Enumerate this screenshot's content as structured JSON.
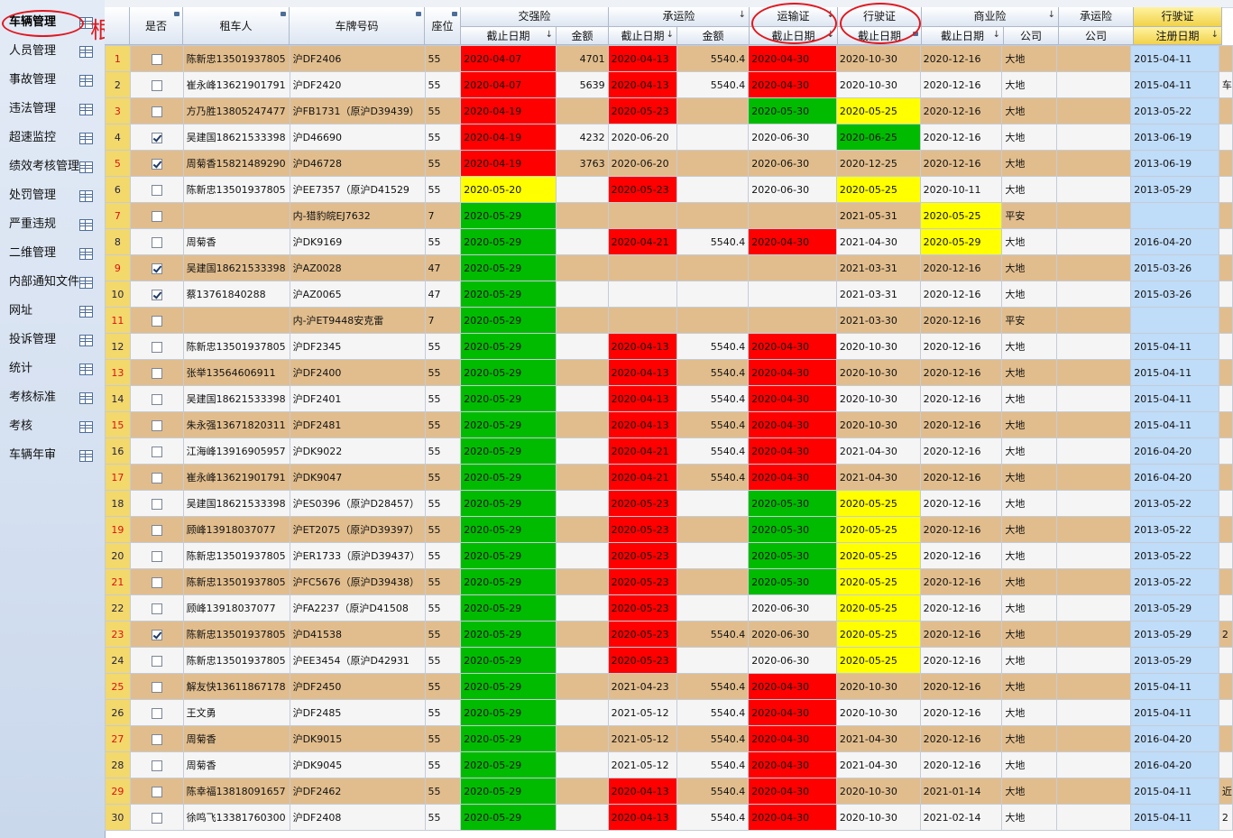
{
  "annotation": {
    "text": "根据该表"
  },
  "sidebar": {
    "items": [
      {
        "label": "车辆管理"
      },
      {
        "label": "人员管理"
      },
      {
        "label": "事故管理"
      },
      {
        "label": "违法管理"
      },
      {
        "label": "超速监控"
      },
      {
        "label": "绩效考核管理"
      },
      {
        "label": "处罚管理"
      },
      {
        "label": "严重违规"
      },
      {
        "label": "二维管理"
      },
      {
        "label": "内部通知文件"
      },
      {
        "label": "网址"
      },
      {
        "label": "投诉管理"
      },
      {
        "label": "统计"
      },
      {
        "label": "考核标准"
      },
      {
        "label": "考核"
      },
      {
        "label": "车辆年审"
      }
    ]
  },
  "header": {
    "top": {
      "col_checkbox": "是否",
      "col_renter": "租车人",
      "col_plate": "车牌号码",
      "col_seat": "座位",
      "group_jqx": "交强险",
      "group_cyx": "承运险",
      "group_ysz": "运输证",
      "group_xsz": "行驶证",
      "group_syx": "商业险",
      "group_cyx2": "承运险",
      "group_xsz2": "行驶证"
    },
    "bottom": {
      "jqx_date": "截止日期",
      "jqx_amount": "金额",
      "cyx_date": "截止日期",
      "cyx_amount": "金额",
      "ysz_date": "截止日期",
      "xsz_date": "截止日期",
      "syx_date": "截止日期",
      "syx_company": "公司",
      "cyx2_company": "公司",
      "xsz2_regdate": "注册日期"
    }
  },
  "colors": {
    "red": "#ff0000",
    "green": "#00bb00",
    "yellow": "#ffff00",
    "odd_row": "#e1bd8d",
    "even_row": "#f5f5f5",
    "reg_col": "#bfdcf8",
    "annotation": "#e0181f"
  },
  "rows": [
    {
      "n": "1",
      "c": false,
      "renter": "陈新忠13501937805",
      "plate": "沪DF2406",
      "seat": "55",
      "jqx": "2020-04-07",
      "jqx_c": "red",
      "jqx_amt": "4701",
      "cyx": "2020-04-13",
      "cyx_c": "red",
      "cyx_amt": "5540.4",
      "ysz": "2020-04-30",
      "ysz_c": "red",
      "xsz": "2020-10-30",
      "xsz_c": "",
      "syx": "2020-12-16",
      "syx_c": "",
      "co": "大地",
      "co2": "",
      "reg": "2015-04-11",
      "extra": ""
    },
    {
      "n": "2",
      "c": false,
      "renter": "崔永峰13621901791",
      "plate": "沪DF2420",
      "seat": "55",
      "jqx": "2020-04-07",
      "jqx_c": "red",
      "jqx_amt": "5639",
      "cyx": "2020-04-13",
      "cyx_c": "red",
      "cyx_amt": "5540.4",
      "ysz": "2020-04-30",
      "ysz_c": "red",
      "xsz": "2020-10-30",
      "xsz_c": "",
      "syx": "2020-12-16",
      "syx_c": "",
      "co": "大地",
      "co2": "",
      "reg": "2015-04-11",
      "extra": "车"
    },
    {
      "n": "3",
      "c": false,
      "renter": "方乃胜13805247477",
      "plate": "沪FB1731（原沪D39439）",
      "seat": "55",
      "jqx": "2020-04-19",
      "jqx_c": "red",
      "jqx_amt": "",
      "cyx": "2020-05-23",
      "cyx_c": "red",
      "cyx_amt": "",
      "ysz": "2020-05-30",
      "ysz_c": "green",
      "xsz": "2020-05-25",
      "xsz_c": "yellow",
      "syx": "2020-12-16",
      "syx_c": "",
      "co": "大地",
      "co2": "",
      "reg": "2013-05-22",
      "extra": ""
    },
    {
      "n": "4",
      "c": true,
      "renter": "吴建国18621533398",
      "plate": "沪D46690",
      "seat": "55",
      "jqx": "2020-04-19",
      "jqx_c": "red",
      "jqx_amt": "4232",
      "cyx": "2020-06-20",
      "cyx_c": "",
      "cyx_amt": "",
      "ysz": "2020-06-30",
      "ysz_c": "",
      "xsz": "2020-06-25",
      "xsz_c": "green",
      "syx": "2020-12-16",
      "syx_c": "",
      "co": "大地",
      "co2": "",
      "reg": "2013-06-19",
      "extra": ""
    },
    {
      "n": "5",
      "c": true,
      "renter": "周菊香15821489290",
      "plate": "沪D46728",
      "seat": "55",
      "jqx": "2020-04-19",
      "jqx_c": "red",
      "jqx_amt": "3763",
      "cyx": "2020-06-20",
      "cyx_c": "",
      "cyx_amt": "",
      "ysz": "2020-06-30",
      "ysz_c": "",
      "xsz": "2020-12-25",
      "xsz_c": "",
      "syx": "2020-12-16",
      "syx_c": "",
      "co": "大地",
      "co2": "",
      "reg": "2013-06-19",
      "extra": ""
    },
    {
      "n": "6",
      "c": false,
      "renter": "陈新忠13501937805",
      "plate": "沪EE7357（原沪D41529",
      "seat": "55",
      "jqx": "2020-05-20",
      "jqx_c": "yellow",
      "jqx_amt": "",
      "cyx": "2020-05-23",
      "cyx_c": "red",
      "cyx_amt": "",
      "ysz": "2020-06-30",
      "ysz_c": "",
      "xsz": "2020-05-25",
      "xsz_c": "yellow",
      "syx": "2020-10-11",
      "syx_c": "",
      "co": "大地",
      "co2": "",
      "reg": "2013-05-29",
      "extra": ""
    },
    {
      "n": "7",
      "c": false,
      "renter": "",
      "plate": "内-猎豹皖EJ7632",
      "seat": "7",
      "jqx": "2020-05-29",
      "jqx_c": "green",
      "jqx_amt": "",
      "cyx": "",
      "cyx_c": "",
      "cyx_amt": "",
      "ysz": "",
      "ysz_c": "",
      "xsz": "2021-05-31",
      "xsz_c": "",
      "syx": "2020-05-25",
      "syx_c": "yellow",
      "co": "平安",
      "co2": "",
      "reg": "",
      "extra": ""
    },
    {
      "n": "8",
      "c": false,
      "renter": "周菊香",
      "plate": "沪DK9169",
      "seat": "55",
      "jqx": "2020-05-29",
      "jqx_c": "green",
      "jqx_amt": "",
      "cyx": "2020-04-21",
      "cyx_c": "red",
      "cyx_amt": "5540.4",
      "ysz": "2020-04-30",
      "ysz_c": "red",
      "xsz": "2021-04-30",
      "xsz_c": "",
      "syx": "2020-05-29",
      "syx_c": "yellow",
      "co": "大地",
      "co2": "",
      "reg": "2016-04-20",
      "extra": ""
    },
    {
      "n": "9",
      "c": true,
      "renter": "吴建国18621533398",
      "plate": "沪AZ0028",
      "seat": "47",
      "jqx": "2020-05-29",
      "jqx_c": "green",
      "jqx_amt": "",
      "cyx": "",
      "cyx_c": "",
      "cyx_amt": "",
      "ysz": "",
      "ysz_c": "",
      "xsz": "2021-03-31",
      "xsz_c": "",
      "syx": "2020-12-16",
      "syx_c": "",
      "co": "大地",
      "co2": "",
      "reg": "2015-03-26",
      "extra": ""
    },
    {
      "n": "10",
      "c": true,
      "renter": "蔡13761840288",
      "plate": "沪AZ0065",
      "seat": "47",
      "jqx": "2020-05-29",
      "jqx_c": "green",
      "jqx_amt": "",
      "cyx": "",
      "cyx_c": "",
      "cyx_amt": "",
      "ysz": "",
      "ysz_c": "",
      "xsz": "2021-03-31",
      "xsz_c": "",
      "syx": "2020-12-16",
      "syx_c": "",
      "co": "大地",
      "co2": "",
      "reg": "2015-03-26",
      "extra": ""
    },
    {
      "n": "11",
      "c": false,
      "renter": "",
      "plate": "内-沪ET9448安克雷",
      "seat": "7",
      "jqx": "2020-05-29",
      "jqx_c": "green",
      "jqx_amt": "",
      "cyx": "",
      "cyx_c": "",
      "cyx_amt": "",
      "ysz": "",
      "ysz_c": "",
      "xsz": "2021-03-30",
      "xsz_c": "",
      "syx": "2020-12-16",
      "syx_c": "",
      "co": "平安",
      "co2": "",
      "reg": "",
      "extra": ""
    },
    {
      "n": "12",
      "c": false,
      "renter": "陈新忠13501937805",
      "plate": "沪DF2345",
      "seat": "55",
      "jqx": "2020-05-29",
      "jqx_c": "green",
      "jqx_amt": "",
      "cyx": "2020-04-13",
      "cyx_c": "red",
      "cyx_amt": "5540.4",
      "ysz": "2020-04-30",
      "ysz_c": "red",
      "xsz": "2020-10-30",
      "xsz_c": "",
      "syx": "2020-12-16",
      "syx_c": "",
      "co": "大地",
      "co2": "",
      "reg": "2015-04-11",
      "extra": ""
    },
    {
      "n": "13",
      "c": false,
      "renter": "张举13564606911",
      "plate": "沪DF2400",
      "seat": "55",
      "jqx": "2020-05-29",
      "jqx_c": "green",
      "jqx_amt": "",
      "cyx": "2020-04-13",
      "cyx_c": "red",
      "cyx_amt": "5540.4",
      "ysz": "2020-04-30",
      "ysz_c": "red",
      "xsz": "2020-10-30",
      "xsz_c": "",
      "syx": "2020-12-16",
      "syx_c": "",
      "co": "大地",
      "co2": "",
      "reg": "2015-04-11",
      "extra": ""
    },
    {
      "n": "14",
      "c": false,
      "renter": "吴建国18621533398",
      "plate": "沪DF2401",
      "seat": "55",
      "jqx": "2020-05-29",
      "jqx_c": "green",
      "jqx_amt": "",
      "cyx": "2020-04-13",
      "cyx_c": "red",
      "cyx_amt": "5540.4",
      "ysz": "2020-04-30",
      "ysz_c": "red",
      "xsz": "2020-10-30",
      "xsz_c": "",
      "syx": "2020-12-16",
      "syx_c": "",
      "co": "大地",
      "co2": "",
      "reg": "2015-04-11",
      "extra": ""
    },
    {
      "n": "15",
      "c": false,
      "renter": "朱永强13671820311",
      "plate": "沪DF2481",
      "seat": "55",
      "jqx": "2020-05-29",
      "jqx_c": "green",
      "jqx_amt": "",
      "cyx": "2020-04-13",
      "cyx_c": "red",
      "cyx_amt": "5540.4",
      "ysz": "2020-04-30",
      "ysz_c": "red",
      "xsz": "2020-10-30",
      "xsz_c": "",
      "syx": "2020-12-16",
      "syx_c": "",
      "co": "大地",
      "co2": "",
      "reg": "2015-04-11",
      "extra": ""
    },
    {
      "n": "16",
      "c": false,
      "renter": "江海峰13916905957",
      "plate": "沪DK9022",
      "seat": "55",
      "jqx": "2020-05-29",
      "jqx_c": "green",
      "jqx_amt": "",
      "cyx": "2020-04-21",
      "cyx_c": "red",
      "cyx_amt": "5540.4",
      "ysz": "2020-04-30",
      "ysz_c": "red",
      "xsz": "2021-04-30",
      "xsz_c": "",
      "syx": "2020-12-16",
      "syx_c": "",
      "co": "大地",
      "co2": "",
      "reg": "2016-04-20",
      "extra": ""
    },
    {
      "n": "17",
      "c": false,
      "renter": "崔永峰13621901791",
      "plate": "沪DK9047",
      "seat": "55",
      "jqx": "2020-05-29",
      "jqx_c": "green",
      "jqx_amt": "",
      "cyx": "2020-04-21",
      "cyx_c": "red",
      "cyx_amt": "5540.4",
      "ysz": "2020-04-30",
      "ysz_c": "red",
      "xsz": "2021-04-30",
      "xsz_c": "",
      "syx": "2020-12-16",
      "syx_c": "",
      "co": "大地",
      "co2": "",
      "reg": "2016-04-20",
      "extra": ""
    },
    {
      "n": "18",
      "c": false,
      "renter": "吴建国18621533398",
      "plate": "沪ES0396（原沪D28457）",
      "seat": "55",
      "jqx": "2020-05-29",
      "jqx_c": "green",
      "jqx_amt": "",
      "cyx": "2020-05-23",
      "cyx_c": "red",
      "cyx_amt": "",
      "ysz": "2020-05-30",
      "ysz_c": "green",
      "xsz": "2020-05-25",
      "xsz_c": "yellow",
      "syx": "2020-12-16",
      "syx_c": "",
      "co": "大地",
      "co2": "",
      "reg": "2013-05-22",
      "extra": ""
    },
    {
      "n": "19",
      "c": false,
      "renter": "顾峰13918037077",
      "plate": "沪ET2075（原沪D39397）",
      "seat": "55",
      "jqx": "2020-05-29",
      "jqx_c": "green",
      "jqx_amt": "",
      "cyx": "2020-05-23",
      "cyx_c": "red",
      "cyx_amt": "",
      "ysz": "2020-05-30",
      "ysz_c": "green",
      "xsz": "2020-05-25",
      "xsz_c": "yellow",
      "syx": "2020-12-16",
      "syx_c": "",
      "co": "大地",
      "co2": "",
      "reg": "2013-05-22",
      "extra": ""
    },
    {
      "n": "20",
      "c": false,
      "renter": "陈新忠13501937805",
      "plate": "沪ER1733（原沪D39437）",
      "seat": "55",
      "jqx": "2020-05-29",
      "jqx_c": "green",
      "jqx_amt": "",
      "cyx": "2020-05-23",
      "cyx_c": "red",
      "cyx_amt": "",
      "ysz": "2020-05-30",
      "ysz_c": "green",
      "xsz": "2020-05-25",
      "xsz_c": "yellow",
      "syx": "2020-12-16",
      "syx_c": "",
      "co": "大地",
      "co2": "",
      "reg": "2013-05-22",
      "extra": ""
    },
    {
      "n": "21",
      "c": false,
      "renter": "陈新忠13501937805",
      "plate": "沪FC5676（原沪D39438）",
      "seat": "55",
      "jqx": "2020-05-29",
      "jqx_c": "green",
      "jqx_amt": "",
      "cyx": "2020-05-23",
      "cyx_c": "red",
      "cyx_amt": "",
      "ysz": "2020-05-30",
      "ysz_c": "green",
      "xsz": "2020-05-25",
      "xsz_c": "yellow",
      "syx": "2020-12-16",
      "syx_c": "",
      "co": "大地",
      "co2": "",
      "reg": "2013-05-22",
      "extra": ""
    },
    {
      "n": "22",
      "c": false,
      "renter": "顾峰13918037077",
      "plate": "沪FA2237（原沪D41508",
      "seat": "55",
      "jqx": "2020-05-29",
      "jqx_c": "green",
      "jqx_amt": "",
      "cyx": "2020-05-23",
      "cyx_c": "red",
      "cyx_amt": "",
      "ysz": "2020-06-30",
      "ysz_c": "",
      "xsz": "2020-05-25",
      "xsz_c": "yellow",
      "syx": "2020-12-16",
      "syx_c": "",
      "co": "大地",
      "co2": "",
      "reg": "2013-05-29",
      "extra": ""
    },
    {
      "n": "23",
      "c": true,
      "renter": "陈新忠13501937805",
      "plate": "沪D41538",
      "seat": "55",
      "jqx": "2020-05-29",
      "jqx_c": "green",
      "jqx_amt": "",
      "cyx": "2020-05-23",
      "cyx_c": "red",
      "cyx_amt": "5540.4",
      "ysz": "2020-06-30",
      "ysz_c": "",
      "xsz": "2020-05-25",
      "xsz_c": "yellow",
      "syx": "2020-12-16",
      "syx_c": "",
      "co": "大地",
      "co2": "",
      "reg": "2013-05-29",
      "extra": "2"
    },
    {
      "n": "24",
      "c": false,
      "renter": "陈新忠13501937805",
      "plate": "沪EE3454（原沪D42931",
      "seat": "55",
      "jqx": "2020-05-29",
      "jqx_c": "green",
      "jqx_amt": "",
      "cyx": "2020-05-23",
      "cyx_c": "red",
      "cyx_amt": "",
      "ysz": "2020-06-30",
      "ysz_c": "",
      "xsz": "2020-05-25",
      "xsz_c": "yellow",
      "syx": "2020-12-16",
      "syx_c": "",
      "co": "大地",
      "co2": "",
      "reg": "2013-05-29",
      "extra": ""
    },
    {
      "n": "25",
      "c": false,
      "renter": "解友快13611867178",
      "plate": "沪DF2450",
      "seat": "55",
      "jqx": "2020-05-29",
      "jqx_c": "green",
      "jqx_amt": "",
      "cyx": "2021-04-23",
      "cyx_c": "",
      "cyx_amt": "5540.4",
      "ysz": "2020-04-30",
      "ysz_c": "red",
      "xsz": "2020-10-30",
      "xsz_c": "",
      "syx": "2020-12-16",
      "syx_c": "",
      "co": "大地",
      "co2": "",
      "reg": "2015-04-11",
      "extra": ""
    },
    {
      "n": "26",
      "c": false,
      "renter": "王文勇",
      "plate": "沪DF2485",
      "seat": "55",
      "jqx": "2020-05-29",
      "jqx_c": "green",
      "jqx_amt": "",
      "cyx": "2021-05-12",
      "cyx_c": "",
      "cyx_amt": "5540.4",
      "ysz": "2020-04-30",
      "ysz_c": "red",
      "xsz": "2020-10-30",
      "xsz_c": "",
      "syx": "2020-12-16",
      "syx_c": "",
      "co": "大地",
      "co2": "",
      "reg": "2015-04-11",
      "extra": ""
    },
    {
      "n": "27",
      "c": false,
      "renter": "周菊香",
      "plate": "沪DK9015",
      "seat": "55",
      "jqx": "2020-05-29",
      "jqx_c": "green",
      "jqx_amt": "",
      "cyx": "2021-05-12",
      "cyx_c": "",
      "cyx_amt": "5540.4",
      "ysz": "2020-04-30",
      "ysz_c": "red",
      "xsz": "2021-04-30",
      "xsz_c": "",
      "syx": "2020-12-16",
      "syx_c": "",
      "co": "大地",
      "co2": "",
      "reg": "2016-04-20",
      "extra": ""
    },
    {
      "n": "28",
      "c": false,
      "renter": "周菊香",
      "plate": "沪DK9045",
      "seat": "55",
      "jqx": "2020-05-29",
      "jqx_c": "green",
      "jqx_amt": "",
      "cyx": "2021-05-12",
      "cyx_c": "",
      "cyx_amt": "5540.4",
      "ysz": "2020-04-30",
      "ysz_c": "red",
      "xsz": "2021-04-30",
      "xsz_c": "",
      "syx": "2020-12-16",
      "syx_c": "",
      "co": "大地",
      "co2": "",
      "reg": "2016-04-20",
      "extra": ""
    },
    {
      "n": "29",
      "c": false,
      "renter": "陈幸福13818091657",
      "plate": "沪DF2462",
      "seat": "55",
      "jqx": "2020-05-29",
      "jqx_c": "green",
      "jqx_amt": "",
      "cyx": "2020-04-13",
      "cyx_c": "red",
      "cyx_amt": "5540.4",
      "ysz": "2020-04-30",
      "ysz_c": "red",
      "xsz": "2020-10-30",
      "xsz_c": "",
      "syx": "2021-01-14",
      "syx_c": "",
      "co": "大地",
      "co2": "",
      "reg": "2015-04-11",
      "extra": "近"
    },
    {
      "n": "30",
      "c": false,
      "renter": "徐鸣飞13381760300",
      "plate": "沪DF2408",
      "seat": "55",
      "jqx": "2020-05-29",
      "jqx_c": "green",
      "jqx_amt": "",
      "cyx": "2020-04-13",
      "cyx_c": "red",
      "cyx_amt": "5540.4",
      "ysz": "2020-04-30",
      "ysz_c": "red",
      "xsz": "2020-10-30",
      "xsz_c": "",
      "syx": "2021-02-14",
      "syx_c": "",
      "co": "大地",
      "co2": "",
      "reg": "2015-04-11",
      "extra": "2"
    }
  ]
}
